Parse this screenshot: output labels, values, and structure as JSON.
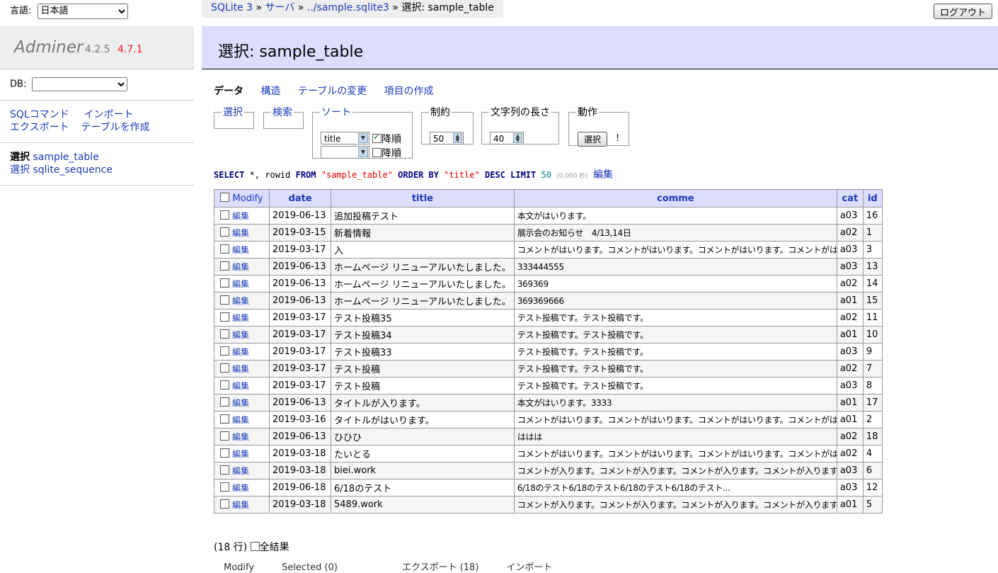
{
  "lang": {
    "label": "言語:",
    "value": "日本語"
  },
  "brand": {
    "name": "Adminer",
    "version": "4.2.5",
    "new_version": "4.7.1"
  },
  "db": {
    "label": "DB:",
    "value": ""
  },
  "links": {
    "sql": "SQLコマンド",
    "import": "インポート",
    "export": "エクスポート",
    "create": "テーブルを作成"
  },
  "tables": [
    {
      "action": "選択",
      "name": "sample_table"
    },
    {
      "action": "選択",
      "name": "sqlite_sequence"
    }
  ],
  "breadcrumb": {
    "driver": "SQLite 3",
    "sep": "»",
    "server": "サーバ",
    "db": "../sample.sqlite3",
    "current": "選択: sample_table"
  },
  "logout": "ログアウト",
  "page_title": "選択: sample_table",
  "tabs": {
    "data": "データ",
    "structure": "構造",
    "alter": "テーブルの変更",
    "new_item": "項目の作成"
  },
  "fieldsets": {
    "select": "選択",
    "search": "検索",
    "sort": {
      "legend": "ソート",
      "field": "title",
      "desc_label": "降順",
      "desc_checked": true,
      "field2": "",
      "desc2_label": "降順",
      "desc2_checked": false
    },
    "limit": {
      "legend": "制約",
      "value": "50"
    },
    "text_length": {
      "legend": "文字列の長さ",
      "value": "40"
    },
    "action": {
      "legend": "動作",
      "button": "選択",
      "mark": "!"
    }
  },
  "query": {
    "select_kw": "SELECT",
    "cols": " *, rowid ",
    "from_kw": "FROM",
    "table": "\"sample_table\"",
    "order_kw": "ORDER BY",
    "order_col": "\"title\"",
    "desc_kw": "DESC",
    "limit_kw": "LIMIT",
    "limit_val": "50",
    "time": "(0.000 秒)",
    "edit": "編集"
  },
  "table": {
    "modify_label": "Modify",
    "columns": [
      "date",
      "title",
      "comme",
      "cat",
      "id"
    ],
    "edit_label": "編集",
    "rows": [
      [
        "2019-06-13",
        "追加投稿テスト",
        "本文がはいります。",
        "a03",
        "16"
      ],
      [
        "2019-03-15",
        "新着情報",
        "展示会のお知らせ　4/13,14日",
        "a02",
        "1"
      ],
      [
        "2019-03-17",
        "入",
        "コメントがはいります。コメントがはいります。コメントがはいります。コメントがはい...",
        "a03",
        "3"
      ],
      [
        "2019-06-13",
        "ホームページ リニューアルいたしました。",
        "333444555",
        "a03",
        "13"
      ],
      [
        "2019-06-13",
        "ホームページ リニューアルいたしました。",
        "369369",
        "a02",
        "14"
      ],
      [
        "2019-06-13",
        "ホームページ リニューアルいたしました。",
        "369369666",
        "a01",
        "15"
      ],
      [
        "2019-03-17",
        "テスト投稿35",
        "テスト投稿です。テスト投稿です。",
        "a02",
        "11"
      ],
      [
        "2019-03-17",
        "テスト投稿34",
        "テスト投稿です。テスト投稿です。",
        "a01",
        "10"
      ],
      [
        "2019-03-17",
        "テスト投稿33",
        "テスト投稿です。テスト投稿です。",
        "a03",
        "9"
      ],
      [
        "2019-03-17",
        "テスト投稿",
        "テスト投稿です。テスト投稿です。",
        "a02",
        "7"
      ],
      [
        "2019-03-17",
        "テスト投稿",
        "テスト投稿です。テスト投稿です。",
        "a03",
        "8"
      ],
      [
        "2019-06-13",
        "タイトルが入ります。",
        "本文がはいります。3333",
        "a01",
        "17"
      ],
      [
        "2019-03-16",
        "タイトルがはいります。",
        "コメントがはいります。コメントがはいります。コメントがはいります。コメントがはい...",
        "a01",
        "2"
      ],
      [
        "2019-06-13",
        "ひひひ",
        "ははは",
        "a02",
        "18"
      ],
      [
        "2019-03-18",
        "たいとる",
        "コメントがはいります。コメントがはいります。コメントがはいります。コメントがはい...",
        "a02",
        "4"
      ],
      [
        "2019-03-18",
        "biei.work",
        "コメントが入ります。コメントが入ります。コメントが入ります。コメントが入ります。...",
        "a03",
        "6"
      ],
      [
        "2019-06-18",
        "6/18のテスト",
        "6/18のテスト6/18のテスト6/18のテスト6/18のテスト...",
        "a03",
        "12"
      ],
      [
        "2019-03-18",
        "5489.work",
        "コメントが入ります。コメントが入ります。コメントが入ります。コメントが入ります。...",
        "a01",
        "5"
      ]
    ]
  },
  "count": {
    "text": "(18 行)",
    "all_label": "全結果"
  },
  "footer_cut": "Modify　　　Selected (0)　　　　　　　エクスポート (18)　　　インポート"
}
